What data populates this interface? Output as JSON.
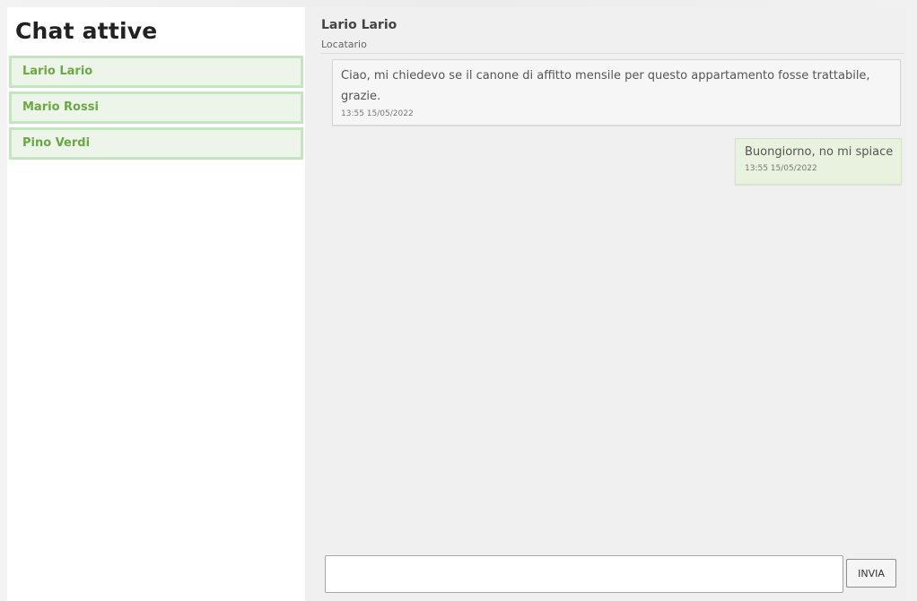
{
  "sidebar": {
    "title": "Chat attive",
    "chats": [
      {
        "name": "Lario Lario"
      },
      {
        "name": "Mario Rossi"
      },
      {
        "name": "Pino Verdi"
      }
    ]
  },
  "conversation": {
    "contact_name": "Lario Lario",
    "contact_role": "Locatario",
    "messages": [
      {
        "direction": "received",
        "text": "Ciao, mi chiedevo se il canone di affitto mensile per questo appartamento fosse trattabile, grazie.",
        "timestamp": "13:55 15/05/2022"
      },
      {
        "direction": "sent",
        "text": "Buongiorno, no mi spiace",
        "timestamp": "13:55 15/05/2022"
      }
    ]
  },
  "composer": {
    "value": "",
    "placeholder": "",
    "send_label": "INVIA"
  },
  "colors": {
    "chat_item_text": "#6aa844",
    "chat_item_border": "#c6e4c2",
    "chat_item_bg": "#edf4ea",
    "sent_bubble_bg": "#e8f2df",
    "received_bubble_bg": "#f6f6f6"
  }
}
